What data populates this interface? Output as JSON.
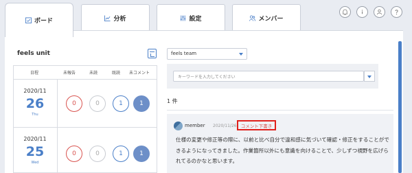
{
  "tabs": [
    {
      "label": "ボード",
      "icon": "checkbox-calendar-icon",
      "active": true
    },
    {
      "label": "分析",
      "icon": "chart-icon",
      "active": false
    },
    {
      "label": "設定",
      "icon": "sliders-icon",
      "active": false
    },
    {
      "label": "メンバー",
      "icon": "people-icon",
      "active": false
    }
  ],
  "top_icons": [
    "bell-icon",
    "info-icon",
    "user-icon",
    "help-icon"
  ],
  "unit": {
    "title": "feels unit"
  },
  "table": {
    "headers": [
      "日程",
      "未報告",
      "未読",
      "既読",
      "未コメント"
    ],
    "rows": [
      {
        "year": "2020/11",
        "day": "26",
        "dow": "Thu",
        "unreported": "0",
        "unread": "0",
        "read": "1",
        "uncommented": "1"
      },
      {
        "year": "2020/11",
        "day": "25",
        "dow": "Wed",
        "unreported": "0",
        "unread": "0",
        "read": "1",
        "uncommented": "1"
      }
    ]
  },
  "team": {
    "selected": "feels team"
  },
  "search": {
    "placeholder": "キーワードを入力してください"
  },
  "results": {
    "count": "1 件"
  },
  "post": {
    "author": "member",
    "date": "2020/11/26",
    "draft_label": "コメント下書き",
    "body": "仕様の変更や修正等の際に、以前と比べ自分で違和感に気づいて確認・修正をすることができるようになってきました。作業箇所以外にも意識を向けることで、少しずつ視野を広げられてるのかなと思います。"
  },
  "colors": {
    "accent": "#4a7fc8",
    "alert": "#d9534f",
    "highlight_border": "#e0201c"
  }
}
